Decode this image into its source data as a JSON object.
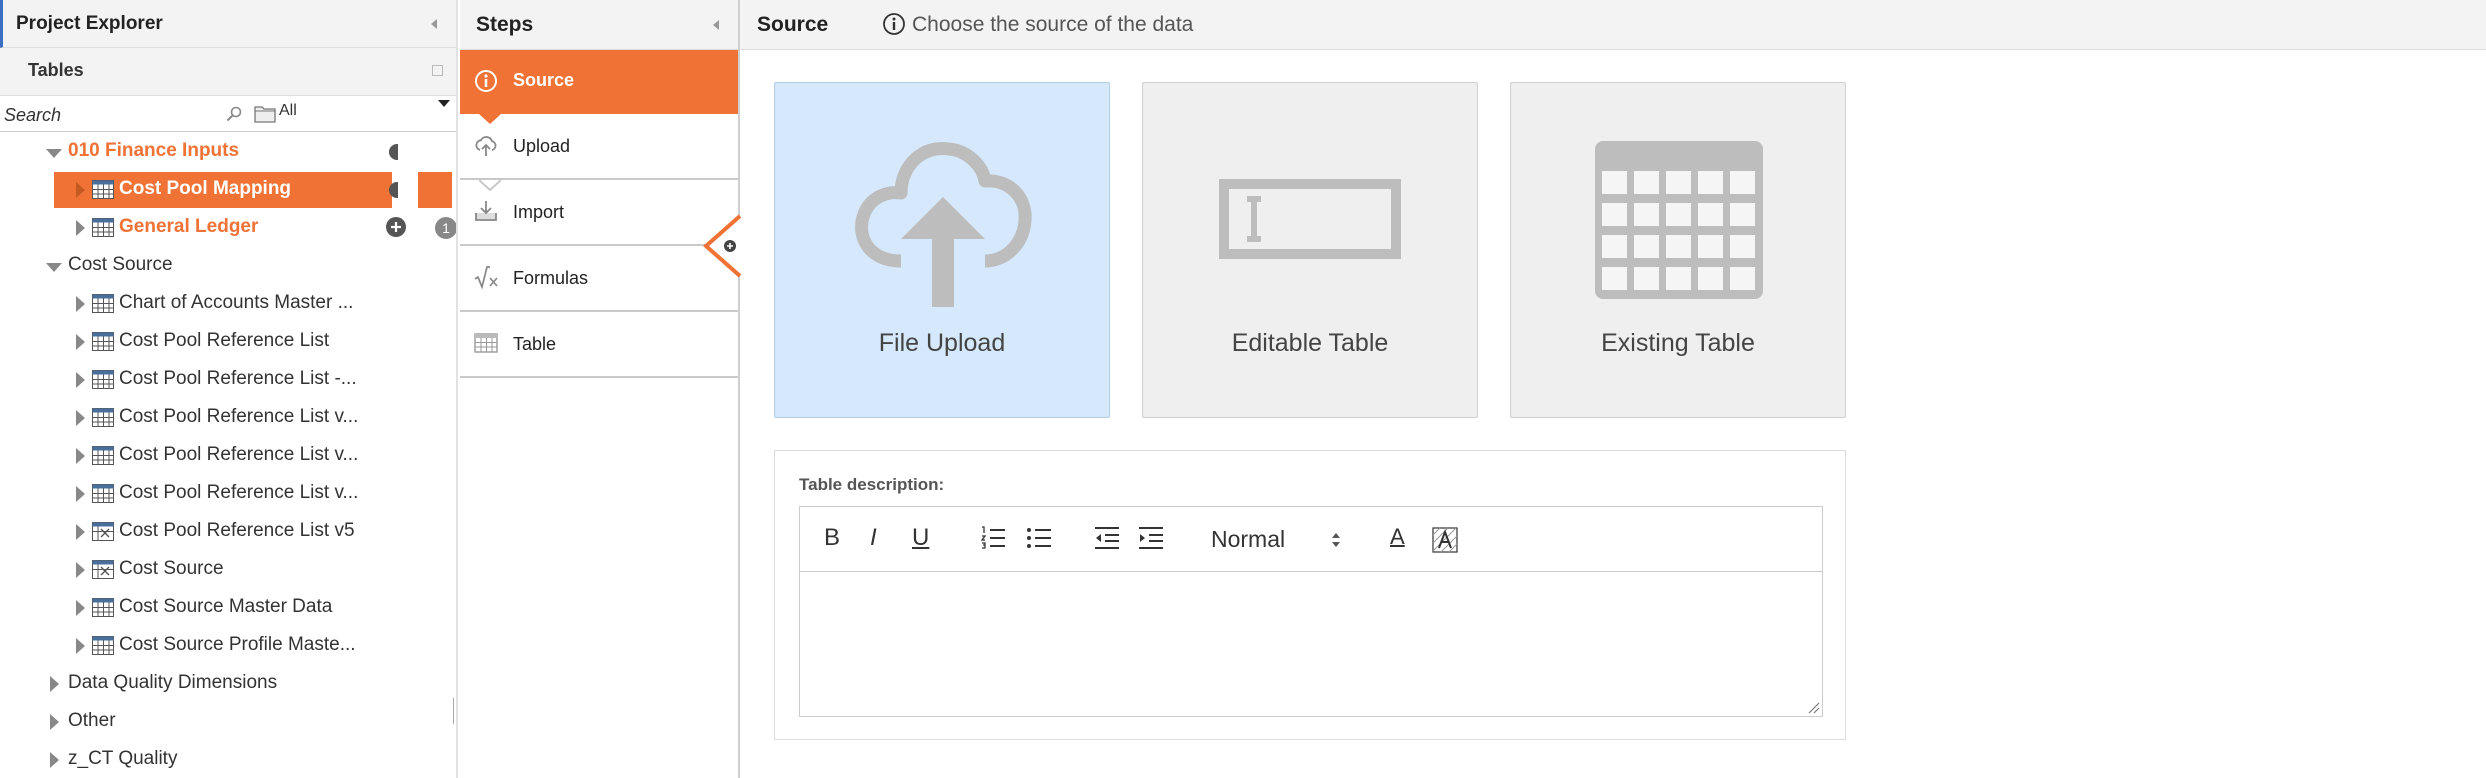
{
  "explorer": {
    "title": "Project Explorer",
    "tables_title": "Tables",
    "search_placeholder": "Search",
    "filter_value": "All",
    "tree": {
      "group1": {
        "label": "010 Finance Inputs"
      },
      "cost_pool_mapping": {
        "label": "Cost Pool Mapping"
      },
      "general_ledger": {
        "label": "General Ledger",
        "badge": "1"
      },
      "group2": {
        "label": "Cost Source"
      },
      "items": [
        {
          "label": "Chart of Accounts Master ..."
        },
        {
          "label": "Cost Pool Reference List"
        },
        {
          "label": "Cost Pool Reference List -..."
        },
        {
          "label": "Cost Pool Reference List v..."
        },
        {
          "label": "Cost Pool Reference List v..."
        },
        {
          "label": "Cost Pool Reference List v..."
        },
        {
          "label": "Cost Pool Reference List v5"
        },
        {
          "label": "Cost Source"
        },
        {
          "label": "Cost Source Master Data"
        },
        {
          "label": "Cost Source Profile Maste..."
        }
      ],
      "group3": {
        "label": "Data Quality Dimensions"
      },
      "group4": {
        "label": "Other"
      },
      "group5": {
        "label": "z_CT Quality"
      }
    }
  },
  "steps": {
    "title": "Steps",
    "items": [
      {
        "label": "Source",
        "icon": "info-icon"
      },
      {
        "label": "Upload",
        "icon": "cloud-upload-icon"
      },
      {
        "label": "Import",
        "icon": "import-icon"
      },
      {
        "label": "Formulas",
        "icon": "formula-icon"
      },
      {
        "label": "Table",
        "icon": "table-icon"
      }
    ]
  },
  "main": {
    "title": "Source",
    "subtitle": "Choose the source of the data",
    "cards": [
      {
        "label": "File Upload",
        "icon": "cloud-upload-icon"
      },
      {
        "label": "Editable Table",
        "icon": "text-field-icon"
      },
      {
        "label": "Existing Table",
        "icon": "grid-table-icon"
      }
    ],
    "description_label": "Table description:",
    "toolbar": {
      "bold": "B",
      "italic": "I",
      "underline": "U",
      "format_value": "Normal",
      "text_color": "A"
    }
  },
  "colors": {
    "accent": "#f07235",
    "selected_card": "#d6e8fb",
    "card_bg": "#efefef",
    "header_bg": "#f3f3f3"
  }
}
